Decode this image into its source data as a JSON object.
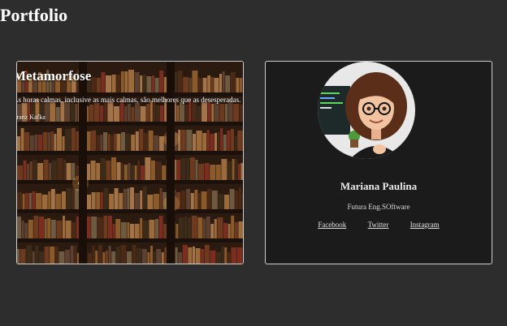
{
  "page": {
    "title": "Portfolio"
  },
  "quote_card": {
    "title": "Metamorfose",
    "text": "As horas calmas, inclusive as mais calmas, são melhores que as desesperadas.",
    "author": "Franz Kafka",
    "background": "bookshelf-library-image"
  },
  "profile_card": {
    "name": "Mariana Paulina",
    "role": "Futura Eng.SOftware",
    "avatar": "cartoon-girl-with-glasses-avatar",
    "links": {
      "facebook": "Facebook",
      "twitter": "Twitter",
      "instagram": "Instagram"
    }
  },
  "colors": {
    "page_bg": "#2d2d2d",
    "card_border": "#cfcfcf",
    "profile_bg": "#1b1b1b"
  }
}
